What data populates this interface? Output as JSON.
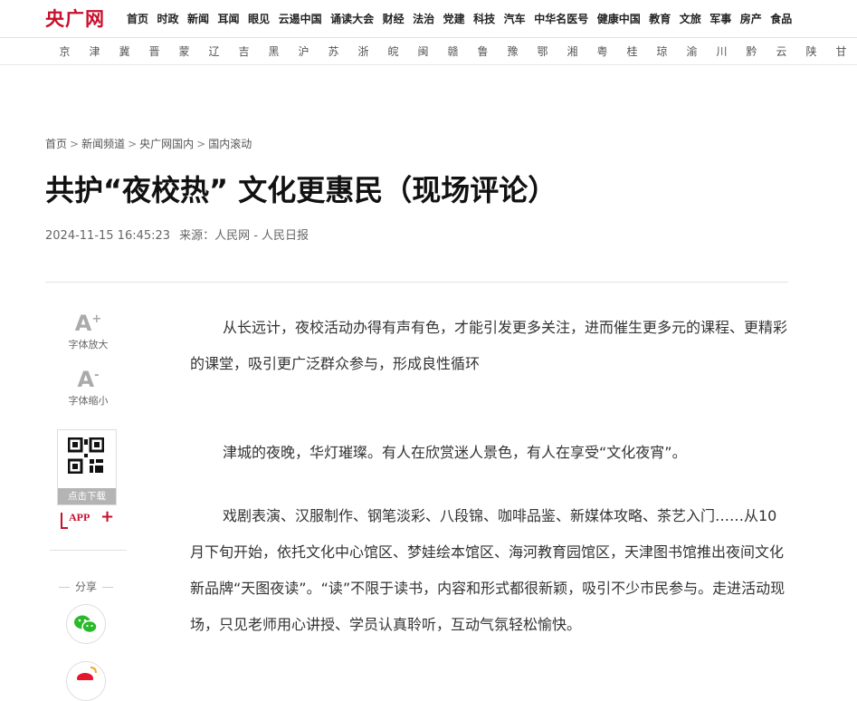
{
  "logo": {
    "text": "央广网"
  },
  "nav": [
    "首页",
    "时政",
    "新闻",
    "耳闻",
    "眼见",
    "云逷中国",
    "诵读大会",
    "财经",
    "法治",
    "党建",
    "科技",
    "汽车",
    "中华名医号",
    "健康中国",
    "教育",
    "文旅",
    "军事",
    "房产",
    "食品"
  ],
  "provinces": [
    "京",
    "津",
    "冀",
    "晋",
    "蒙",
    "辽",
    "吉",
    "黑",
    "沪",
    "苏",
    "浙",
    "皖",
    "闽",
    "赣",
    "鲁",
    "豫",
    "鄂",
    "湘",
    "粤",
    "桂",
    "琼",
    "渝",
    "川",
    "黔",
    "云",
    "陕",
    "甘"
  ],
  "breadcrumb": [
    "首页",
    "新闻频道",
    "央广网国内",
    "国内滚动"
  ],
  "breadcrumb_sep": ">",
  "article": {
    "title": "共护“夜校热” 文化更惠民（现场评论）",
    "datetime": "2024-11-15 16:45:23",
    "source_label": "来源：",
    "source": "人民网 - 人民日报",
    "paragraphs": [
      "从长远计，夜校活动办得有声有色，才能引发更多关注，进而催生更多元的课程、更精彩的课堂，吸引更广泛群众参与，形成良性循环",
      "津城的夜晚，华灯璀璨。有人在欣赏迷人景色，有人在享受“文化夜宵”。",
      "戏剧表演、汉服制作、钢笔淡彩、八段锦、咖啡品鉴、新媒体攻略、茶艺入门……从10月下旬开始，依托文化中心馆区、梦娃绘本馆区、海河教育园馆区，天津图书馆推出夜间文化新品牌“天图夜读”。“读”不限于读书，内容和形式都很新颖，吸引不少市民参与。走进活动现场，只见老师用心讲授、学员认真聆听，互动气氛轻松愉快。"
    ]
  },
  "tools": {
    "font_up_glyph": "A",
    "font_up_sign": "+",
    "font_up_label": "字体放大",
    "font_down_glyph": "A",
    "font_down_sign": "-",
    "font_down_label": "字体缩小",
    "qr_caption": "点击下载",
    "app_label": "APP",
    "app_plus": "+",
    "share_label": "分享"
  },
  "icons": {
    "wechat": "wechat-icon",
    "weibo": "weibo-icon",
    "qr": "qr-code-icon"
  },
  "colors": {
    "brand_red": "#c8102e",
    "wechat_green": "#2ab92a",
    "weibo_red": "#e6162d"
  }
}
